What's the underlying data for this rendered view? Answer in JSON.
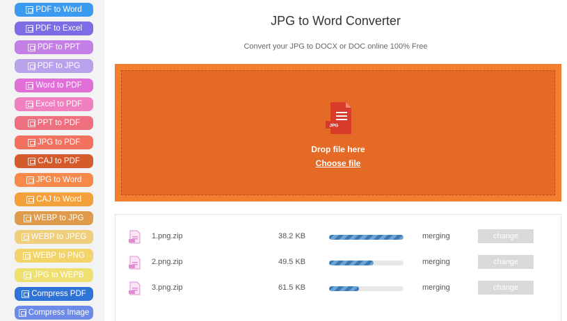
{
  "sidebar": {
    "items": [
      {
        "label": "PDF to Word",
        "color": "#3a9bf0"
      },
      {
        "label": "PDF to Excel",
        "color": "#7c6ce6"
      },
      {
        "label": "PDF to PPT",
        "color": "#c47fe6"
      },
      {
        "label": "PDF to JPG",
        "color": "#b8a2ec"
      },
      {
        "label": "Word to PDF",
        "color": "#e06fd8"
      },
      {
        "label": "Excel to PDF",
        "color": "#f080c0"
      },
      {
        "label": "PPT to PDF",
        "color": "#ef6f7f"
      },
      {
        "label": "JPG to PDF",
        "color": "#f3725f"
      },
      {
        "label": "CAJ to PDF",
        "color": "#d55a2c"
      },
      {
        "label": "JPG to Word",
        "color": "#f78a4a"
      },
      {
        "label": "CAJ to Word",
        "color": "#f5a13b"
      },
      {
        "label": "WEBP to JPG",
        "color": "#e09a4c"
      },
      {
        "label": "WEBP to JPEG",
        "color": "#efce7c"
      },
      {
        "label": "WEBP to PNG",
        "color": "#f2d46a"
      },
      {
        "label": "JPG to WEPB",
        "color": "#ede070"
      },
      {
        "label": "Compress PDF",
        "color": "#2f73d6"
      },
      {
        "label": "Compress Image",
        "color": "#6e8ae8"
      }
    ]
  },
  "header": {
    "title": "JPG to Word Converter",
    "subtitle": "Convert your JPG to DOCX or DOC online 100% Free"
  },
  "dropzone": {
    "icon_label": "JPG",
    "drop_text": "Drop file here",
    "choose_label": "Choose file"
  },
  "files": [
    {
      "name": "1.png.zip",
      "size": "38.2 KB",
      "progress": 1.0,
      "status": "merging",
      "action": "change"
    },
    {
      "name": "2.png.zip",
      "size": "49.5 KB",
      "progress": 0.6,
      "status": "merging",
      "action": "change"
    },
    {
      "name": "3.png.zip",
      "size": "61.5 KB",
      "progress": 0.4,
      "status": "merging",
      "action": "change"
    }
  ],
  "colors": {
    "accent": "#f47d30",
    "dropzone_inner": "#e46a25",
    "progress": "#3b78b4",
    "change_button": "#d9d9d9"
  }
}
